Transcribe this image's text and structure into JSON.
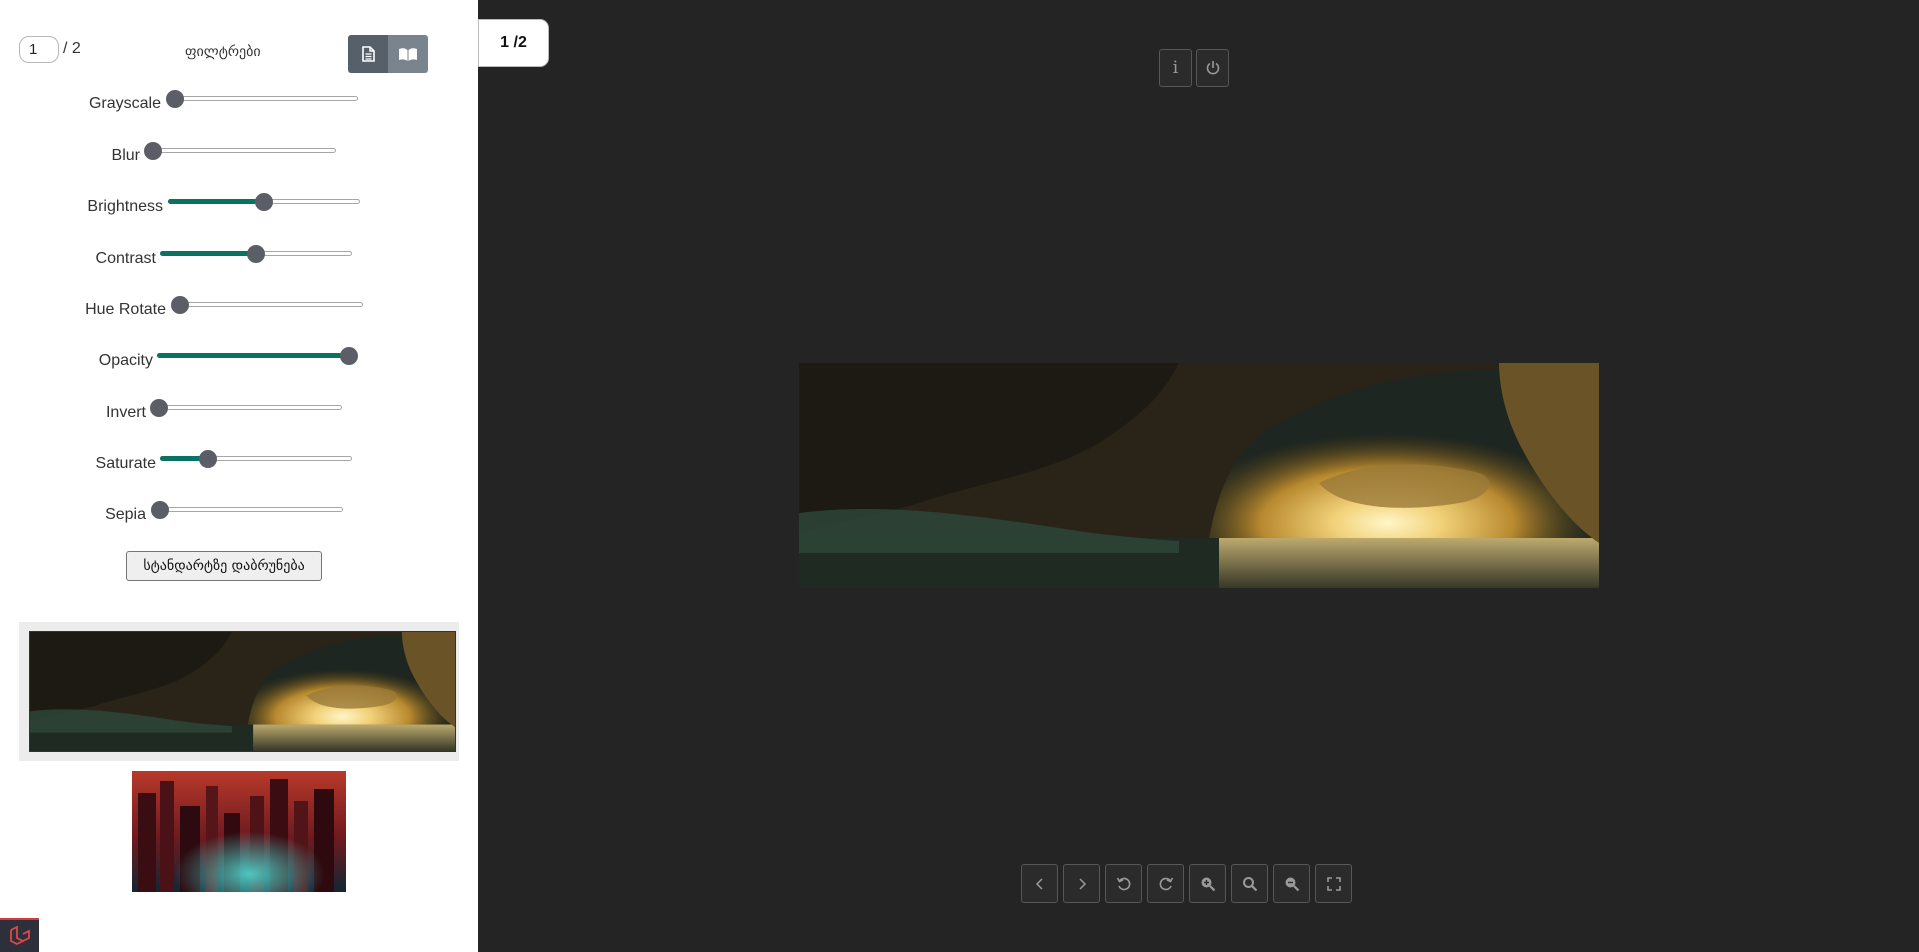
{
  "sidebar": {
    "page_input_value": "1",
    "page_total": "/ 2",
    "filters_title": "ფილტრები",
    "view_modes": [
      {
        "icon": "single-page-icon"
      },
      {
        "icon": "book-icon"
      }
    ],
    "filters": [
      {
        "label": "Grayscale",
        "value_fraction": 0.0
      },
      {
        "label": "Blur",
        "value_fraction": 0.0
      },
      {
        "label": "Brightness",
        "value_fraction": 0.5
      },
      {
        "label": "Contrast",
        "value_fraction": 0.5
      },
      {
        "label": "Hue Rotate",
        "value_fraction": 0.0
      },
      {
        "label": "Opacity",
        "value_fraction": 1.0
      },
      {
        "label": "Invert",
        "value_fraction": 0.0
      },
      {
        "label": "Saturate",
        "value_fraction": 0.25
      },
      {
        "label": "Sepia",
        "value_fraction": 0.0
      }
    ],
    "reset_label": "სტანდარტზე დაბრუნება",
    "thumbnails": [
      {
        "name": "cave-thumbnail",
        "active": true
      },
      {
        "name": "city-thumbnail",
        "active": false
      }
    ]
  },
  "viewer": {
    "page_counter": "1 /2",
    "top_tools": [
      {
        "icon": "info-icon",
        "glyph": "i"
      },
      {
        "icon": "power-icon"
      }
    ],
    "bottom_tools": [
      {
        "icon": "chevron-left-icon"
      },
      {
        "icon": "chevron-right-icon"
      },
      {
        "icon": "rotate-left-icon"
      },
      {
        "icon": "rotate-right-icon"
      },
      {
        "icon": "zoom-in-icon"
      },
      {
        "icon": "search-icon"
      },
      {
        "icon": "zoom-out-icon"
      },
      {
        "icon": "fullscreen-icon"
      }
    ]
  },
  "colors": {
    "viewer_background": "#242424",
    "slider_fill": "#0b7160",
    "slider_thumb": "#5b5e66"
  }
}
